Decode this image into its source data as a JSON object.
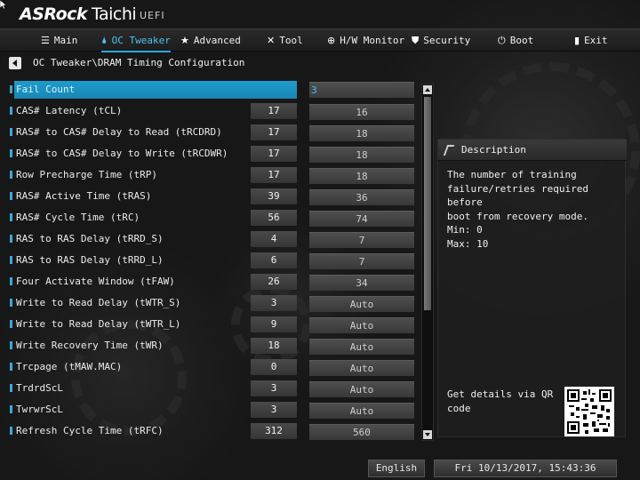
{
  "header": {
    "brand": "ASRock",
    "model": "Taichi",
    "firmware": "UEFI"
  },
  "nav": {
    "tabs": [
      {
        "label": "Main",
        "icon": "list-icon"
      },
      {
        "label": "OC Tweaker",
        "icon": "flame-icon"
      },
      {
        "label": "Advanced",
        "icon": "star-icon"
      },
      {
        "label": "Tool",
        "icon": "tools-icon"
      },
      {
        "label": "H/W Monitor",
        "icon": "globe-icon"
      },
      {
        "label": "Security",
        "icon": "shield-icon"
      },
      {
        "label": "Boot",
        "icon": "power-icon"
      },
      {
        "label": "Exit",
        "icon": "exit-icon"
      }
    ],
    "active_tab": "OC Tweaker"
  },
  "breadcrumb": "OC Tweaker\\DRAM Timing Configuration",
  "settings": {
    "rows": [
      {
        "label": "Fail Count",
        "current": "",
        "value": "3",
        "selected": true
      },
      {
        "label": "CAS# Latency (tCL)",
        "current": "17",
        "value": "16"
      },
      {
        "label": "RAS# to CAS# Delay to Read  (tRCDRD)",
        "current": "17",
        "value": "18"
      },
      {
        "label": "RAS# to CAS# Delay to Write (tRCDWR)",
        "current": "17",
        "value": "18"
      },
      {
        "label": "Row Precharge Time (tRP)",
        "current": "17",
        "value": "18"
      },
      {
        "label": "RAS# Active Time (tRAS)",
        "current": "39",
        "value": "36"
      },
      {
        "label": "RAS# Cycle Time (tRC)",
        "current": "56",
        "value": "74"
      },
      {
        "label": "RAS to RAS Delay (tRRD_S)",
        "current": "4",
        "value": "7"
      },
      {
        "label": "RAS to RAS Delay (tRRD_L)",
        "current": "6",
        "value": "7"
      },
      {
        "label": "Four Activate Window (tFAW)",
        "current": "26",
        "value": "34"
      },
      {
        "label": "Write to Read Delay (tWTR_S)",
        "current": "3",
        "value": "Auto"
      },
      {
        "label": "Write to Read Delay (tWTR_L)",
        "current": "9",
        "value": "Auto"
      },
      {
        "label": "Write Recovery Time (tWR)",
        "current": "18",
        "value": "Auto"
      },
      {
        "label": "Trcpage (tMAW.MAC)",
        "current": "0",
        "value": "Auto"
      },
      {
        "label": "TrdrdScL",
        "current": "3",
        "value": "Auto"
      },
      {
        "label": "TwrwrScL",
        "current": "3",
        "value": "Auto"
      },
      {
        "label": "Refresh Cycle Time  (tRFC)",
        "current": "312",
        "value": "560"
      }
    ]
  },
  "description": {
    "title": "Description",
    "text": "The number of training\nfailure/retries required before\nboot from recovery mode.",
    "min": "Min: 0",
    "max": "Max: 10",
    "qr_text": "Get details via QR\ncode"
  },
  "footer": {
    "language": "English",
    "datetime": "Fri 10/13/2017, 15:43:36"
  },
  "colors": {
    "accent": "#2aa8dc",
    "selected_row": "#1d9ccd",
    "selected_value_text": "#46c0f2"
  }
}
